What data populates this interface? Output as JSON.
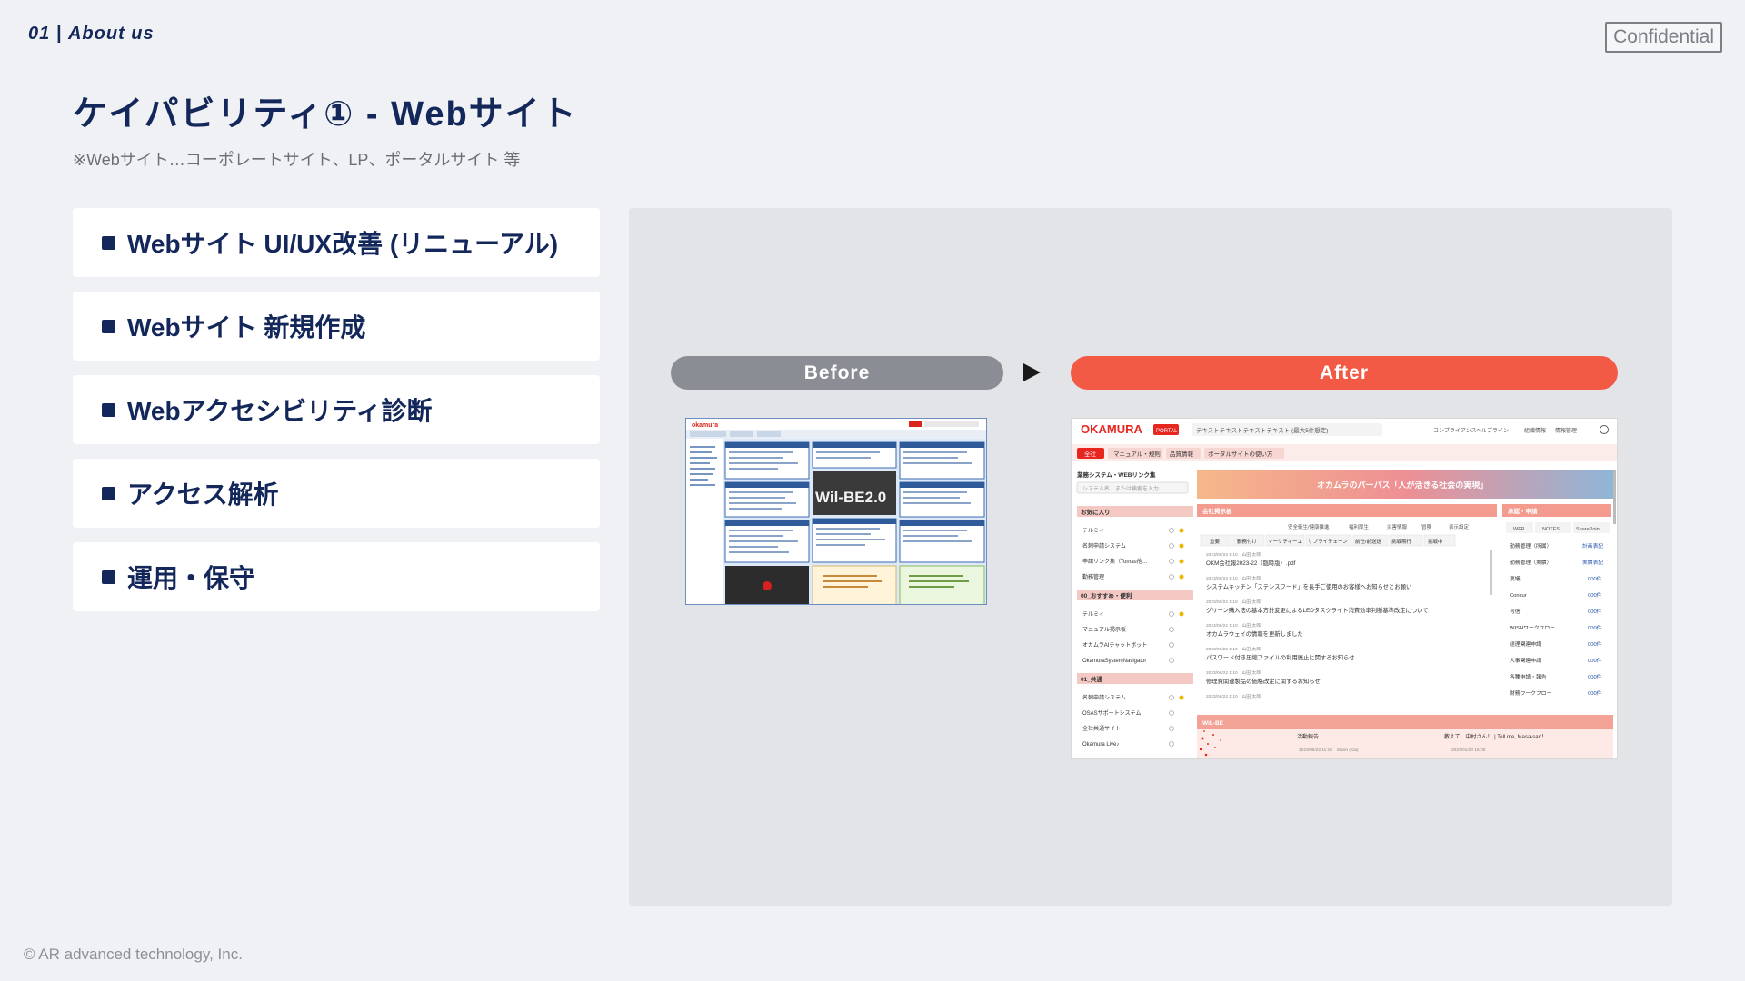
{
  "header": {
    "section_number": "01",
    "section_name": "About us",
    "confidential": "Confidential"
  },
  "title": "ケイパビリティ① - Webサイト",
  "subtitle": "※Webサイト…コーポレートサイト、LP、ポータルサイト 等",
  "capabilities": [
    "Webサイト UI/UX改善 (リニューアル)",
    "Webサイト 新規作成",
    "Webアクセシビリティ診断",
    "アクセス解析",
    "運用・保守"
  ],
  "comparison": {
    "before_label": "Before",
    "after_label": "After",
    "before_screen": {
      "logo": "okamura",
      "banner": "Wil-BE2.0"
    },
    "after_screen": {
      "logo": "OKAMURA",
      "logo_badge": "PORTAL",
      "search_text": "テキストテキストテキストテキスト (最大5件想定)",
      "header_links": [
        "コンプライアンスヘルプライン",
        "組織情報",
        "情報管理"
      ],
      "tabs": [
        "全社",
        "マニュアル・規則",
        "品質情報",
        "ポータルサイトの使い方"
      ],
      "side_title": "業務システム・WEBリンク集",
      "search_placeholder": "システム名、または検索を入力",
      "hero_text": "オカムラのパーパス「人が活きる社会の実現」",
      "sidebar_groups": [
        {
          "title": "お気に入り",
          "items": [
            "テルミィ",
            "名刺申請システム",
            "申請リンク集（Tomas他…",
            "勤務管理"
          ]
        },
        {
          "title": "00_おすすめ・便利",
          "items": [
            "テルミィ",
            "マニュアル掲示板",
            "オカムラAIチャットボット",
            "OkamuraSystemNavigator"
          ]
        },
        {
          "title": "01_共通",
          "items": [
            "名刺申請システム",
            "OSASサポートシステム",
            "全社共通サイト",
            "Okamura Live♪"
          ]
        }
      ],
      "board_title": "会社掲示板",
      "board_links": [
        "安全衛生/健康推進",
        "福利厚生",
        "災害情報",
        "冒険",
        "表示設定"
      ],
      "board_tabs": [
        "重要",
        "勤務付け",
        "マーケティーエ",
        "サプライチェーン",
        "前仕/前送送",
        "挑戦期行",
        "挑戦中"
      ],
      "board_posts": [
        {
          "meta": "2023/06/22 1:10　山田 太郎",
          "title": "OKM会社報2023-22（臨時版）.pdf"
        },
        {
          "meta": "2023/06/22 1:10　山田 太郎",
          "title": "システムキッチン「ステンスフード」を長手ご使用のお客様へお知らせとお願い"
        },
        {
          "meta": "2023/06/22 1:10　山田 太郎",
          "title": "グリーン購入法の基本方針変更によるLEDタスクライト消費効率判断基準改定について"
        },
        {
          "meta": "2023/06/22 1:10　山田 太郎",
          "title": "オカムラウェイの情報を更新しました"
        },
        {
          "meta": "2023/06/22 1:10　山田 太郎",
          "title": "パスワード付き圧縮ファイルの利用廃止に関するお知らせ"
        },
        {
          "meta": "2023/06/22 1:10　山田 太郎",
          "title": "修理費関連製品の価格改定に関するお知らせ"
        },
        {
          "meta": "2023/06/22 1:10　山田 太郎",
          "title": ""
        }
      ],
      "approval_title": "承認・申請",
      "approval_tabs": [
        "WFR",
        "NOTES",
        "SharePoint"
      ],
      "approvals": [
        {
          "label": "勤務管理（所属）",
          "value": "計画表記"
        },
        {
          "label": "勤務管理（実績）",
          "value": "実績表記"
        },
        {
          "label": "稟議",
          "value": "000件"
        },
        {
          "label": "Concur",
          "value": "000件"
        },
        {
          "label": "与信",
          "value": "000件"
        },
        {
          "label": "WISHワークフロー",
          "value": "000件"
        },
        {
          "label": "経理関連申請",
          "value": "000件"
        },
        {
          "label": "人事関連申請",
          "value": "000件"
        },
        {
          "label": "各種申請・報告",
          "value": "000件"
        },
        {
          "label": "財務ワークフロー",
          "value": "000件"
        }
      ],
      "wilbe_title": "WiL-BE",
      "wilbe_col1_title": "活動報告",
      "wilbe_col2_title": "教えて、中村さん！ | Tell me, Masa-san！",
      "wilbe_col1_meta": "2023/06/22 11:10　Shion (Kai)",
      "wilbe_col2_meta": "2023/01/20 16:00"
    }
  },
  "footer": "© AR advanced technology, Inc."
}
